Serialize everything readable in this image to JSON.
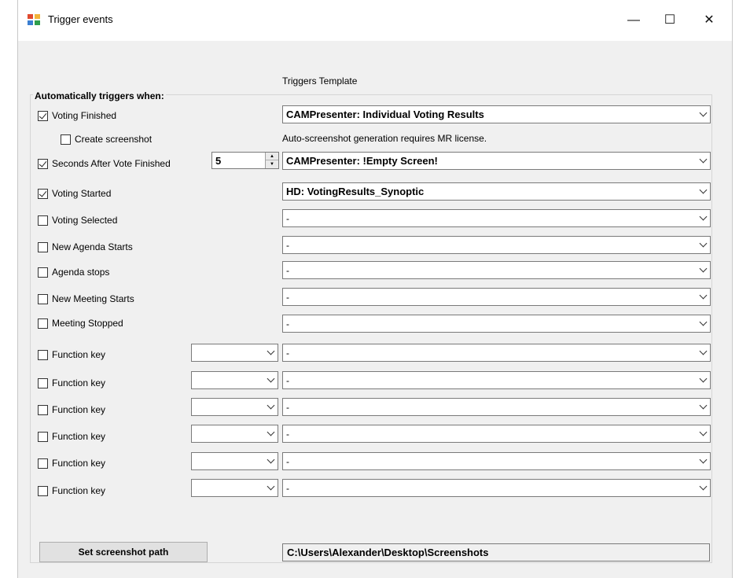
{
  "window": {
    "title": "Trigger events",
    "minimize": "—",
    "maximize": "☐",
    "close": "✕"
  },
  "group_title": "Automatically triggers when:",
  "template_label": "Triggers Template",
  "note": "Auto-screenshot generation requires MR license.",
  "triggers": [
    {
      "label": "Voting Finished",
      "checked": true,
      "template": "CAMPresenter: Individual Voting Results"
    },
    {
      "label": "Create screenshot",
      "checked": false
    },
    {
      "label": "Seconds After Vote Finished",
      "checked": true,
      "seconds": "5",
      "template": "CAMPresenter: !Empty Screen!"
    },
    {
      "label": "Voting Started",
      "checked": true,
      "template": "HD: VotingResults_Synoptic"
    },
    {
      "label": "Voting Selected",
      "checked": false,
      "template": "-"
    },
    {
      "label": "New Agenda Starts",
      "checked": false,
      "template": "-"
    },
    {
      "label": "Agenda stops",
      "checked": false,
      "template": "-"
    },
    {
      "label": "New Meeting Starts",
      "checked": false,
      "template": "-"
    },
    {
      "label": "Meeting Stopped",
      "checked": false,
      "template": "-"
    }
  ],
  "function_keys": [
    {
      "label": "Function key",
      "checked": false,
      "key": "",
      "template": "-"
    },
    {
      "label": "Function key",
      "checked": false,
      "key": "",
      "template": "-"
    },
    {
      "label": "Function key",
      "checked": false,
      "key": "",
      "template": "-"
    },
    {
      "label": "Function key",
      "checked": false,
      "key": "",
      "template": "-"
    },
    {
      "label": "Function key",
      "checked": false,
      "key": "",
      "template": "-"
    },
    {
      "label": "Function key",
      "checked": false,
      "key": "",
      "template": "-"
    }
  ],
  "set_path_button": "Set screenshot path",
  "screenshot_path": "C:\\Users\\Alexander\\Desktop\\Screenshots"
}
